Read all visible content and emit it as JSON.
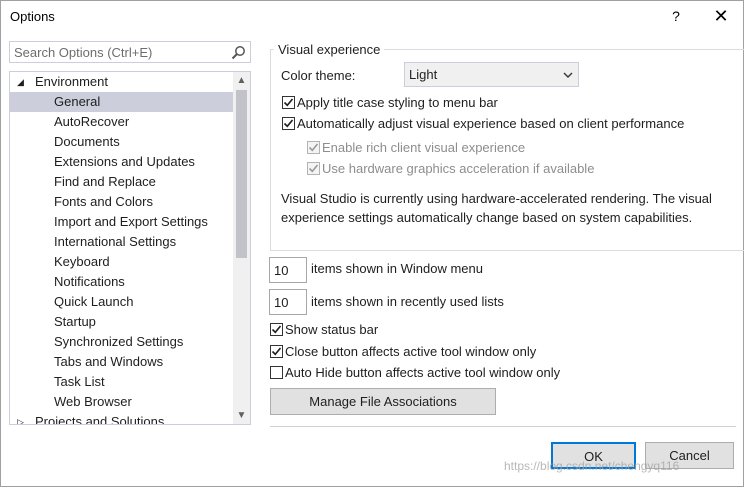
{
  "window": {
    "title": "Options",
    "help_glyph": "?",
    "close_glyph": "✕"
  },
  "search": {
    "placeholder": "Search Options (Ctrl+E)"
  },
  "tree": {
    "items": [
      {
        "label": "Environment",
        "level": 0,
        "expanded": true
      },
      {
        "label": "General",
        "level": 1,
        "selected": true
      },
      {
        "label": "AutoRecover",
        "level": 1
      },
      {
        "label": "Documents",
        "level": 1
      },
      {
        "label": "Extensions and Updates",
        "level": 1
      },
      {
        "label": "Find and Replace",
        "level": 1
      },
      {
        "label": "Fonts and Colors",
        "level": 1
      },
      {
        "label": "Import and Export Settings",
        "level": 1
      },
      {
        "label": "International Settings",
        "level": 1
      },
      {
        "label": "Keyboard",
        "level": 1
      },
      {
        "label": "Notifications",
        "level": 1
      },
      {
        "label": "Quick Launch",
        "level": 1
      },
      {
        "label": "Startup",
        "level": 1
      },
      {
        "label": "Synchronized Settings",
        "level": 1
      },
      {
        "label": "Tabs and Windows",
        "level": 1
      },
      {
        "label": "Task List",
        "level": 1
      },
      {
        "label": "Web Browser",
        "level": 1
      },
      {
        "label": "Projects and Solutions",
        "level": 0,
        "expanded": false
      }
    ],
    "expanded_arrow": "◢",
    "collapsed_arrow": "▷"
  },
  "visual_experience": {
    "group_title": "Visual experience",
    "color_theme_label": "Color theme:",
    "color_theme_value": "Light",
    "apply_title_case": {
      "label": "Apply title case styling to menu bar",
      "checked": true
    },
    "auto_adjust": {
      "label": "Automatically adjust visual experience based on client performance",
      "checked": true
    },
    "rich_client": {
      "label": "Enable rich client visual experience",
      "checked": true,
      "disabled": true
    },
    "hw_accel": {
      "label": "Use hardware graphics acceleration if available",
      "checked": true,
      "disabled": true
    },
    "note": "Visual Studio is currently using hardware-accelerated rendering. The visual experience settings automatically change based on system capabilities."
  },
  "window_menu": {
    "value": "10",
    "label": "items shown in Window menu"
  },
  "recent_lists": {
    "value": "10",
    "label": "items shown in recently used lists"
  },
  "options": {
    "show_status_bar": {
      "label": "Show status bar",
      "checked": true
    },
    "close_button": {
      "label": "Close button affects active tool window only",
      "checked": true
    },
    "auto_hide": {
      "label": "Auto Hide button affects active tool window only",
      "checked": false
    }
  },
  "buttons": {
    "manage_file_assoc": "Manage File Associations",
    "ok": "OK",
    "cancel": "Cancel"
  },
  "watermark": "https://blog.csdn.net/chengyq116",
  "colors": {
    "accent": "#0078d7",
    "selection": "#cccedb"
  }
}
